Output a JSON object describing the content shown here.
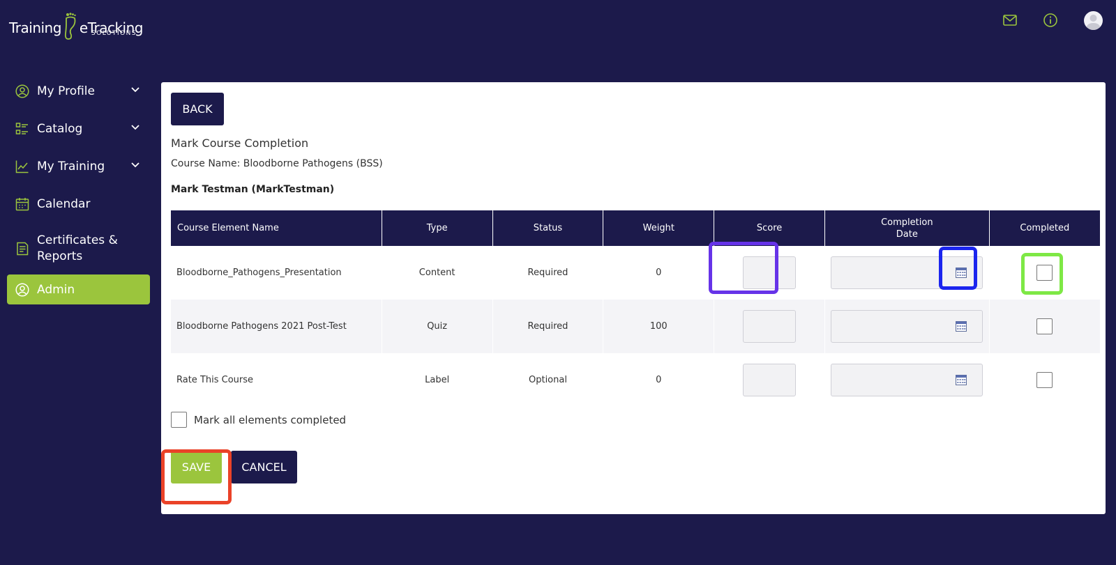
{
  "app": {
    "logo_text_1": "Training",
    "logo_text_2": "eTracking",
    "logo_sub": "SOLUTIONS",
    "accent_color": "#9bc53d",
    "navy_color": "#1c1a4b"
  },
  "header": {
    "icons": [
      "mail-icon",
      "info-icon",
      "avatar"
    ]
  },
  "sidebar": {
    "items": [
      {
        "label": "My Profile",
        "icon": "user-circle-icon",
        "expandable": true
      },
      {
        "label": "Catalog",
        "icon": "list-icon",
        "expandable": true
      },
      {
        "label": "My Training",
        "icon": "chart-line-icon",
        "expandable": true
      },
      {
        "label": "Calendar",
        "icon": "calendar-icon",
        "expandable": false
      },
      {
        "label": "Certificates & Reports",
        "icon": "document-icon",
        "expandable": false
      },
      {
        "label": "Admin",
        "icon": "user-circle-icon",
        "expandable": false,
        "active": true
      }
    ]
  },
  "main": {
    "back_label": "BACK",
    "title": "Mark Course Completion",
    "course_name": "Course Name: Bloodborne Pathogens (BSS)",
    "trainee": "Mark Testman (MarkTestman)",
    "table": {
      "headers": {
        "name": "Course Element Name",
        "type": "Type",
        "status": "Status",
        "weight": "Weight",
        "score": "Score",
        "completion_date_1": "Completion",
        "completion_date_2": "Date",
        "completed": "Completed"
      },
      "rows": [
        {
          "name": "Bloodborne_Pathogens_Presentation",
          "type": "Content",
          "status": "Required",
          "weight": "0",
          "score": "",
          "date": "",
          "completed": false
        },
        {
          "name": "Bloodborne Pathogens 2021 Post-Test",
          "type": "Quiz",
          "status": "Required",
          "weight": "100",
          "score": "",
          "date": "",
          "completed": false
        },
        {
          "name": "Rate This Course",
          "type": "Label",
          "status": "Optional",
          "weight": "0",
          "score": "",
          "date": "",
          "completed": false
        }
      ]
    },
    "mark_all_label": "Mark all elements completed",
    "mark_all_checked": false,
    "save_label": "SAVE",
    "cancel_label": "CANCEL"
  }
}
